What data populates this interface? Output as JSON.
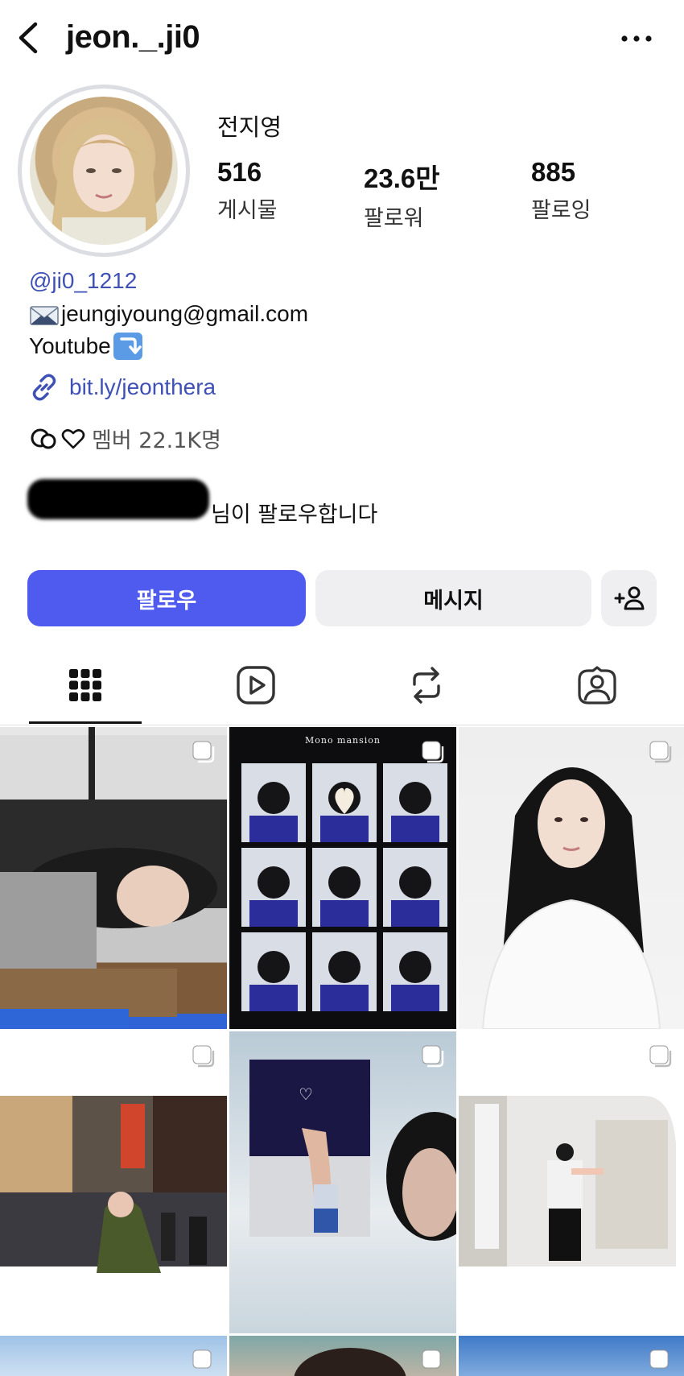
{
  "header": {
    "username": "jeon._.ji0"
  },
  "profile": {
    "display_name": "전지영",
    "stats": [
      {
        "value": "516",
        "label": "게시물"
      },
      {
        "value": "23.6만",
        "label": "팔로워"
      },
      {
        "value": "885",
        "label": "팔로잉"
      }
    ],
    "handle": "@ji0_1212",
    "email": "jeungiyoung@gmail.com",
    "youtube": "Youtube",
    "link": "bit.ly/jeonthera",
    "members": "멤버 22.1K명",
    "followed_by_suffix": "님이 팔로우합니다"
  },
  "actions": {
    "follow": "팔로우",
    "message": "메시지"
  },
  "tabs": [
    "posts-grid",
    "reels",
    "reposts",
    "tagged"
  ],
  "grid_tiles": [
    {
      "caption": ""
    },
    {
      "caption": "Mono mansion"
    },
    {
      "caption": ""
    },
    {
      "caption": ""
    },
    {
      "caption": "♡"
    },
    {
      "caption": ""
    }
  ],
  "colors": {
    "accent": "#4f5bef",
    "link": "#3f51b5",
    "button_bg": "#efeff2"
  }
}
